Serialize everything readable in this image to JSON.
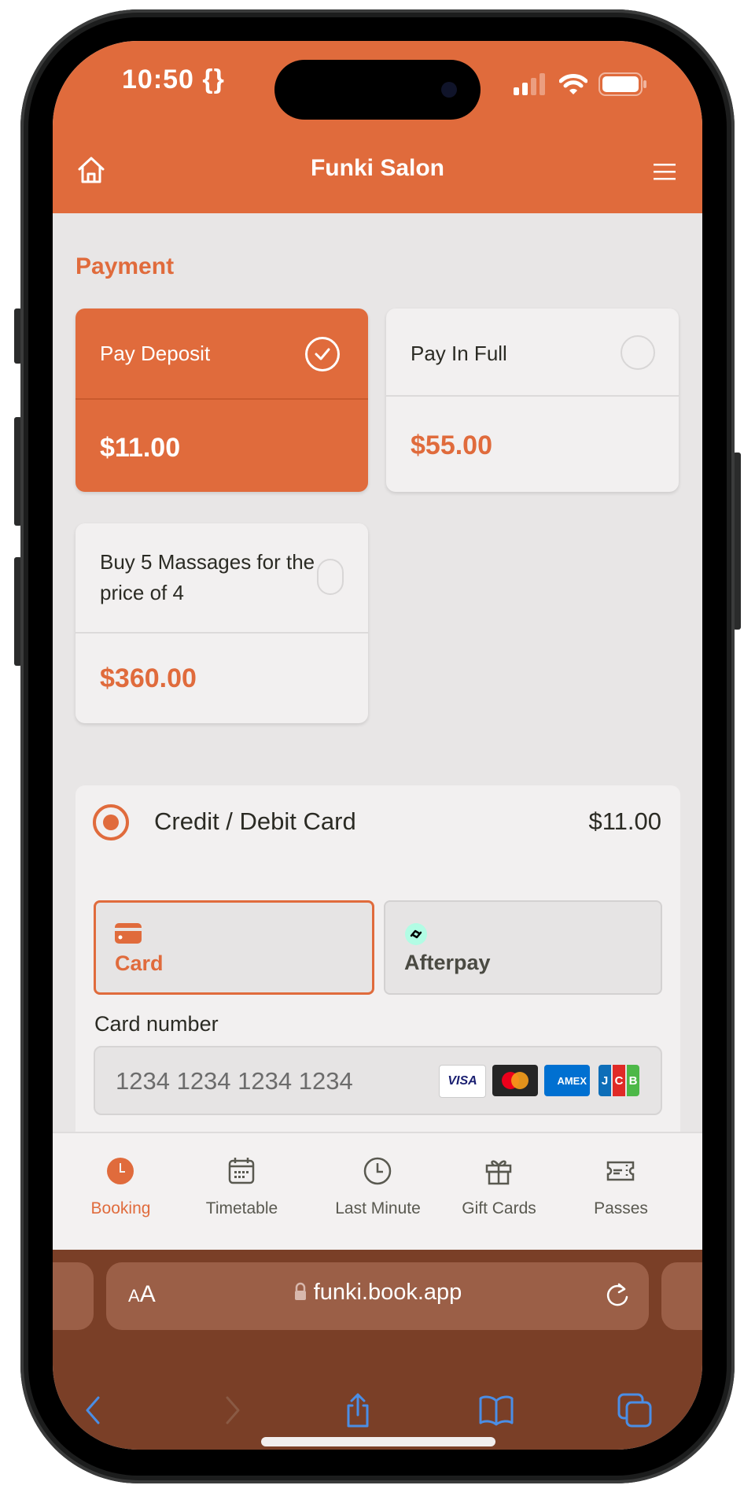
{
  "status_bar": {
    "time": "10:50 {}",
    "icons": [
      "signal-icon",
      "wifi-icon",
      "battery-icon"
    ]
  },
  "header": {
    "title": "Funki Salon",
    "left_icon": "home-icon",
    "right_icon": "menu-icon"
  },
  "payment": {
    "section_title": "Payment",
    "options": [
      {
        "label": "Pay Deposit",
        "price": "$11.00",
        "selected": true
      },
      {
        "label": "Pay In Full",
        "price": "$55.00",
        "selected": false
      },
      {
        "label": "Buy 5 Massages for the price of 4",
        "price": "$360.00",
        "selected": false
      }
    ]
  },
  "method": {
    "label": "Credit / Debit Card",
    "amount": "$11.00",
    "selected": true,
    "tabs": [
      {
        "label": "Card",
        "icon": "credit-card-icon",
        "active": true
      },
      {
        "label": "Afterpay",
        "icon": "afterpay-icon",
        "active": false
      }
    ],
    "card_number_label": "Card number",
    "card_number_placeholder": "1234 1234 1234 1234",
    "card_number_value": "",
    "brands": [
      "VISA",
      "Mastercard",
      "AMEX",
      "JCB"
    ]
  },
  "colors": {
    "accent": "#e06b3c",
    "browser_bar": "#7a3f27",
    "ios_blue": "#4a8ee6"
  },
  "bottom_nav": [
    {
      "label": "Booking",
      "icon": "clock-filled-icon",
      "active": true
    },
    {
      "label": "Timetable",
      "icon": "calendar-icon",
      "active": false
    },
    {
      "label": "Last Minute",
      "icon": "clock-icon",
      "active": false
    },
    {
      "label": "Gift Cards",
      "icon": "gift-icon",
      "active": false
    },
    {
      "label": "Passes",
      "icon": "ticket-icon",
      "active": false
    }
  ],
  "browser": {
    "text_size_label_small": "A",
    "text_size_label_large": "A",
    "url": "funki.book.app",
    "toolbar": [
      "back-icon",
      "forward-icon",
      "share-icon",
      "bookmarks-icon",
      "tabs-icon"
    ]
  }
}
